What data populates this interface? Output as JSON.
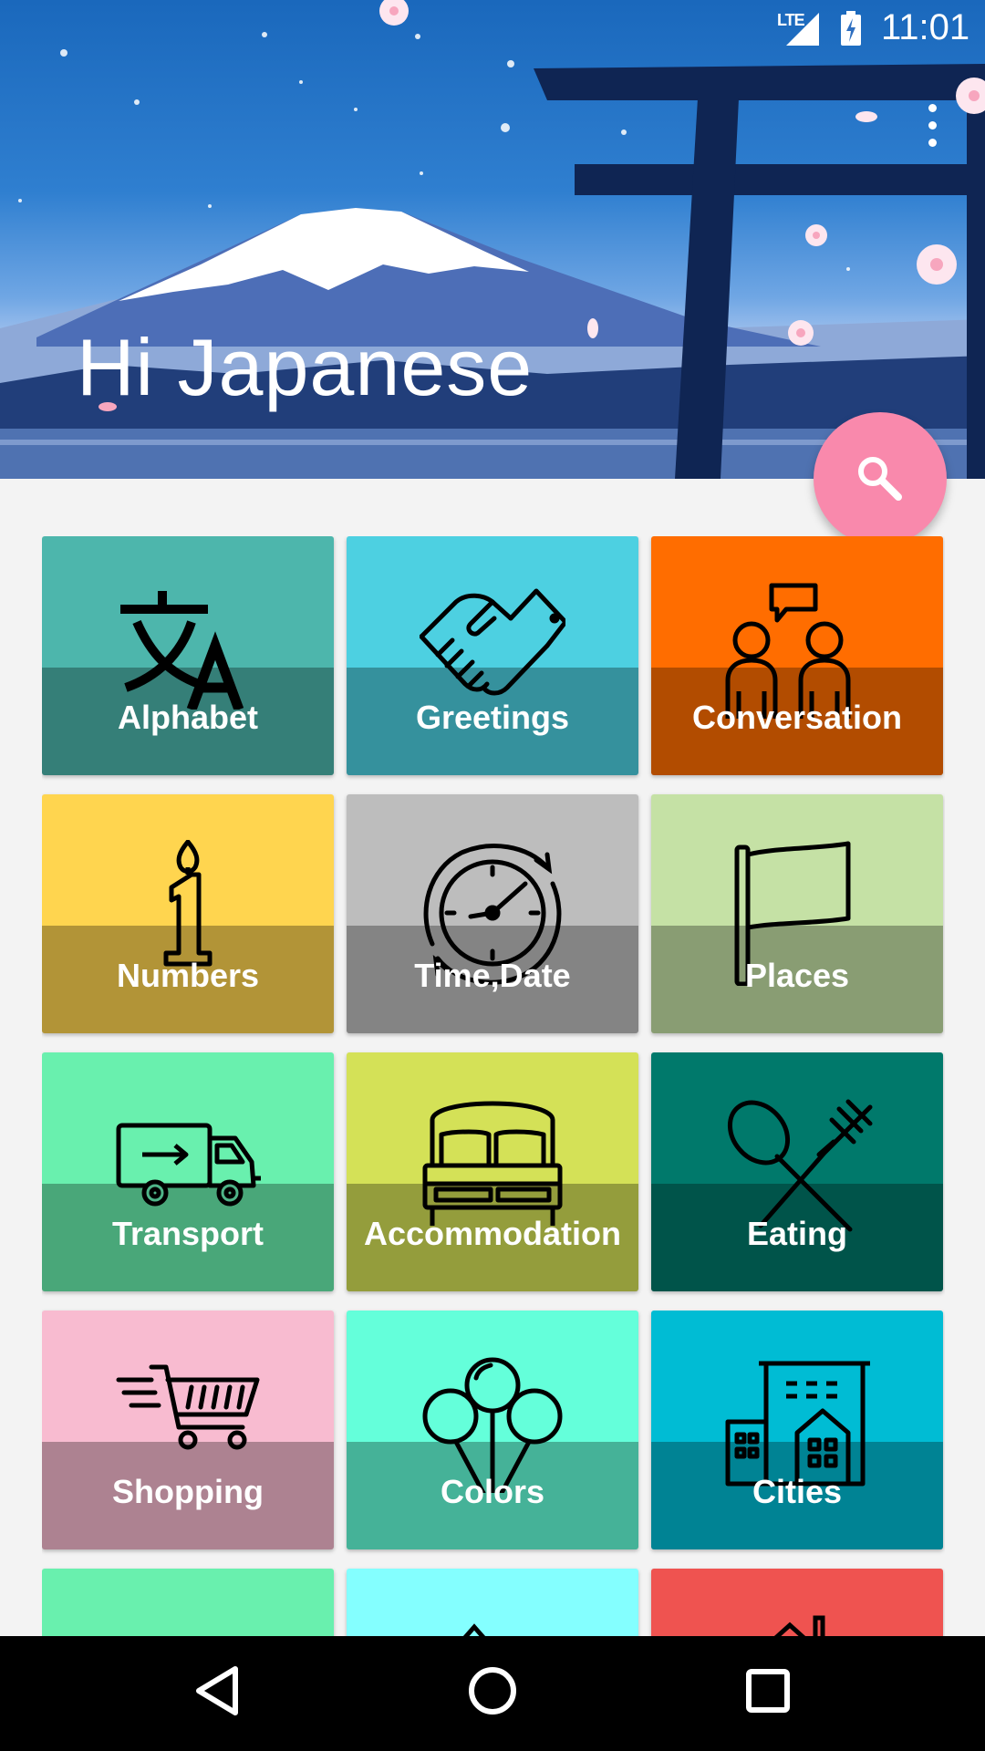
{
  "status_bar": {
    "network": "LTE",
    "time": "11:01"
  },
  "app": {
    "title": "Hi Japanese"
  },
  "fab": {
    "icon": "search-icon"
  },
  "categories": [
    {
      "label": "Alphabet",
      "icon": "translate-icon",
      "color": "#4db6ac"
    },
    {
      "label": "Greetings",
      "icon": "handshake-icon",
      "color": "#4dd0e1"
    },
    {
      "label": "Conversation",
      "icon": "conversation-icon",
      "color": "#ff6d00"
    },
    {
      "label": "Numbers",
      "icon": "candle-number-icon",
      "color": "#ffd54f"
    },
    {
      "label": "Time,Date",
      "icon": "clock-icon",
      "color": "#bdbdbd"
    },
    {
      "label": "Places",
      "icon": "flag-icon",
      "color": "#c5e1a5"
    },
    {
      "label": "Transport",
      "icon": "truck-icon",
      "color": "#69f0ae"
    },
    {
      "label": "Accommodation",
      "icon": "bed-icon",
      "color": "#d4e157"
    },
    {
      "label": "Eating",
      "icon": "fork-spoon-icon",
      "color": "#00796b"
    },
    {
      "label": "Shopping",
      "icon": "cart-icon",
      "color": "#f8bbd0"
    },
    {
      "label": "Colors",
      "icon": "balloons-icon",
      "color": "#64ffda"
    },
    {
      "label": "Cities",
      "icon": "buildings-icon",
      "color": "#00bcd4"
    }
  ],
  "partial_row_colors": [
    "#69f0ae",
    "#84ffff",
    "#ef5350"
  ],
  "navbar": {
    "back": "back-icon",
    "home": "home-icon",
    "recents": "recents-icon"
  }
}
